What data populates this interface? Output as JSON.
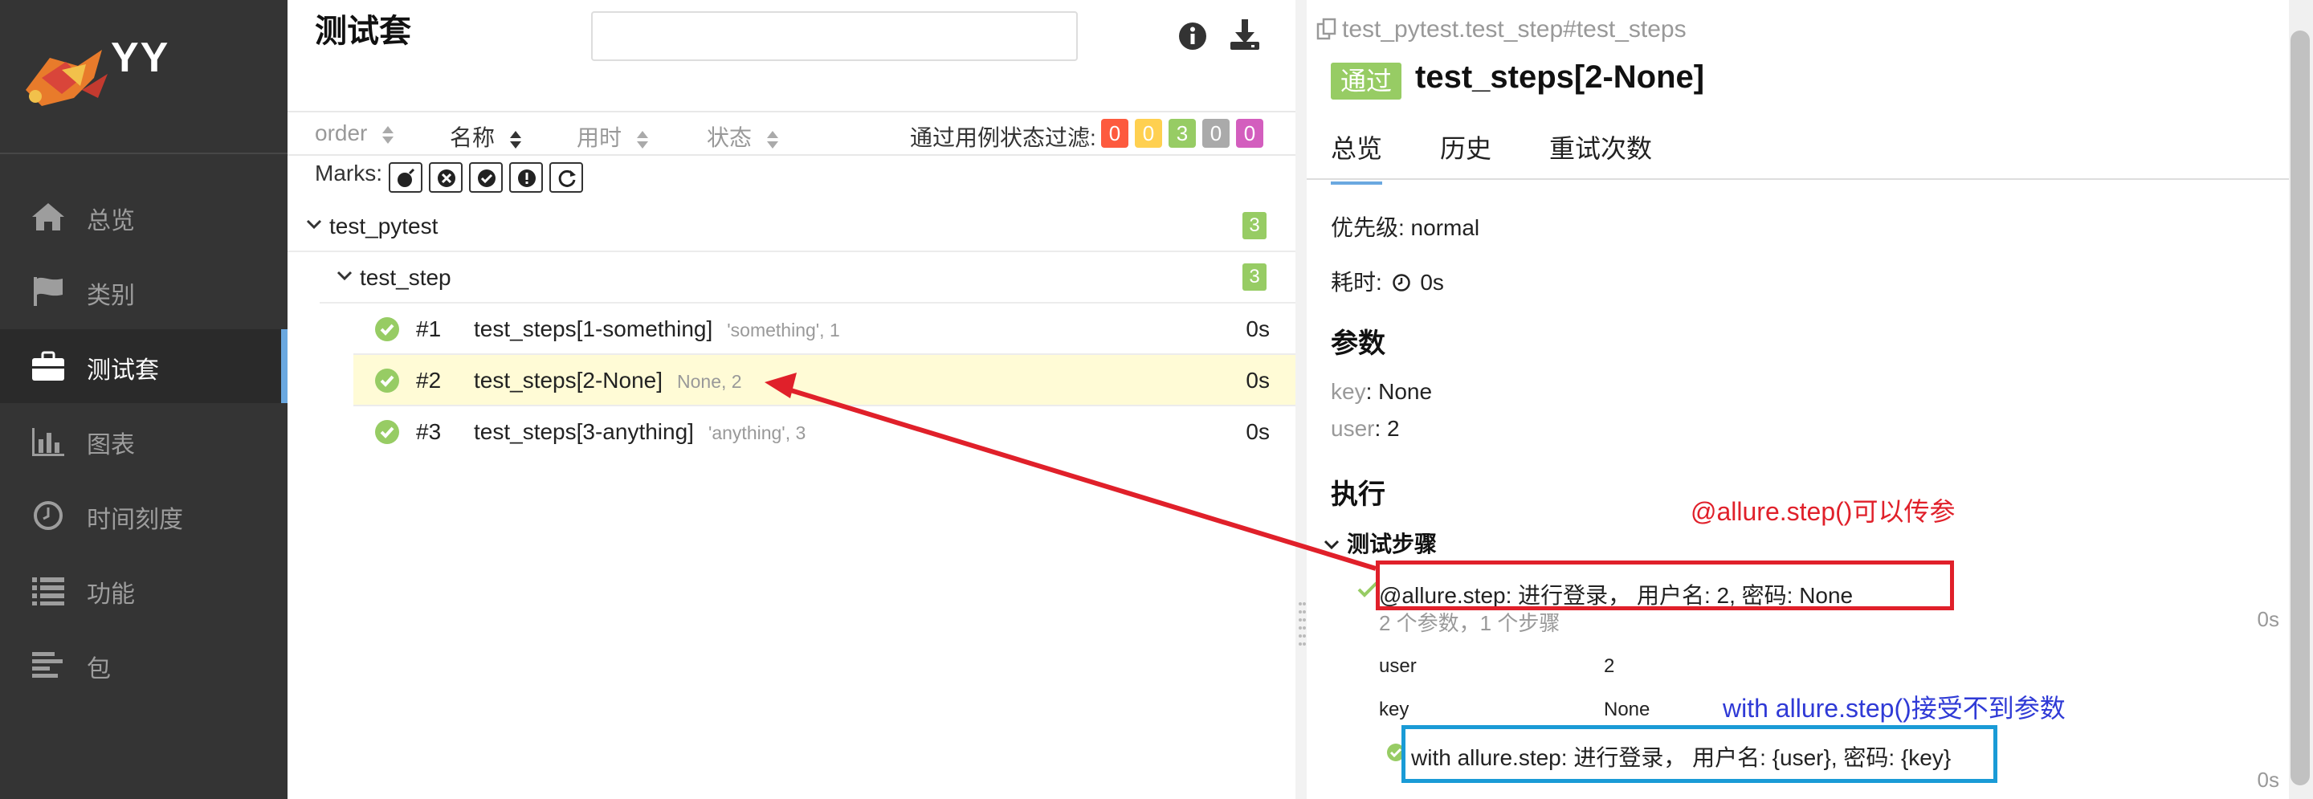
{
  "brand": {
    "name": "YY"
  },
  "sidebar": {
    "items": [
      {
        "label": "总览",
        "icon": "home-icon"
      },
      {
        "label": "类别",
        "icon": "flag-icon"
      },
      {
        "label": "测试套",
        "icon": "briefcase-icon"
      },
      {
        "label": "图表",
        "icon": "bar-chart-icon"
      },
      {
        "label": "时间刻度",
        "icon": "clock-icon"
      },
      {
        "label": "功能",
        "icon": "list-icon"
      },
      {
        "label": "包",
        "icon": "align-left-icon"
      }
    ],
    "active_index": 2
  },
  "suites": {
    "title": "测试套",
    "search": {
      "value": "",
      "placeholder": ""
    },
    "sort": {
      "order": "order",
      "name": "名称",
      "duration": "用时",
      "status": "状态"
    },
    "filter": {
      "label": "通过用例状态过滤:",
      "counts": [
        {
          "value": "0",
          "color": "#fd5a3e"
        },
        {
          "value": "0",
          "color": "#ffd050"
        },
        {
          "value": "3",
          "color": "#97cc64"
        },
        {
          "value": "0",
          "color": "#aaaaaa"
        },
        {
          "value": "0",
          "color": "#d35ebe"
        }
      ]
    },
    "marks_label": "Marks:",
    "tree": {
      "root": {
        "name": "test_pytest",
        "count": "3"
      },
      "child": {
        "name": "test_step",
        "count": "3"
      },
      "cases": [
        {
          "num": "#1",
          "name": "test_steps[1-something]",
          "params": "'something', 1",
          "duration": "0s"
        },
        {
          "num": "#2",
          "name": "test_steps[2-None]",
          "params": "None, 2",
          "duration": "0s",
          "selected": true
        },
        {
          "num": "#3",
          "name": "test_steps[3-anything]",
          "params": "'anything', 3",
          "duration": "0s"
        }
      ]
    }
  },
  "detail": {
    "breadcrumb": "test_pytest.test_step#test_steps",
    "status": "通过",
    "title": "test_steps[2-None]",
    "tabs": [
      "总览",
      "历史",
      "重试次数"
    ],
    "severity": "优先级: normal",
    "duration_label": "耗时:",
    "duration_value": "0s",
    "params_heading": "参数",
    "params": [
      {
        "key": "key",
        "value": ": None"
      },
      {
        "key": "user",
        "value": ": 2"
      }
    ],
    "exec_heading": "执行",
    "steps_heading": "测试步骤",
    "step1": {
      "text": "@allure.step: 进行登录， 用户名: 2, 密码: None",
      "summary": "2 个参数，1 个步骤",
      "duration": "0s",
      "params": [
        {
          "name": "user",
          "value": "2"
        },
        {
          "name": "key",
          "value": "None"
        }
      ]
    },
    "step2": {
      "text": "with allure.step: 进行登录， 用户名: {user}, 密码: {key}",
      "duration": "0s"
    }
  },
  "annotations": {
    "red_note": "@allure.step()可以传参",
    "blue_note": "with allure.step()接受不到参数",
    "red_color": "#e0202a",
    "blue_color": "#1a9bd6"
  }
}
